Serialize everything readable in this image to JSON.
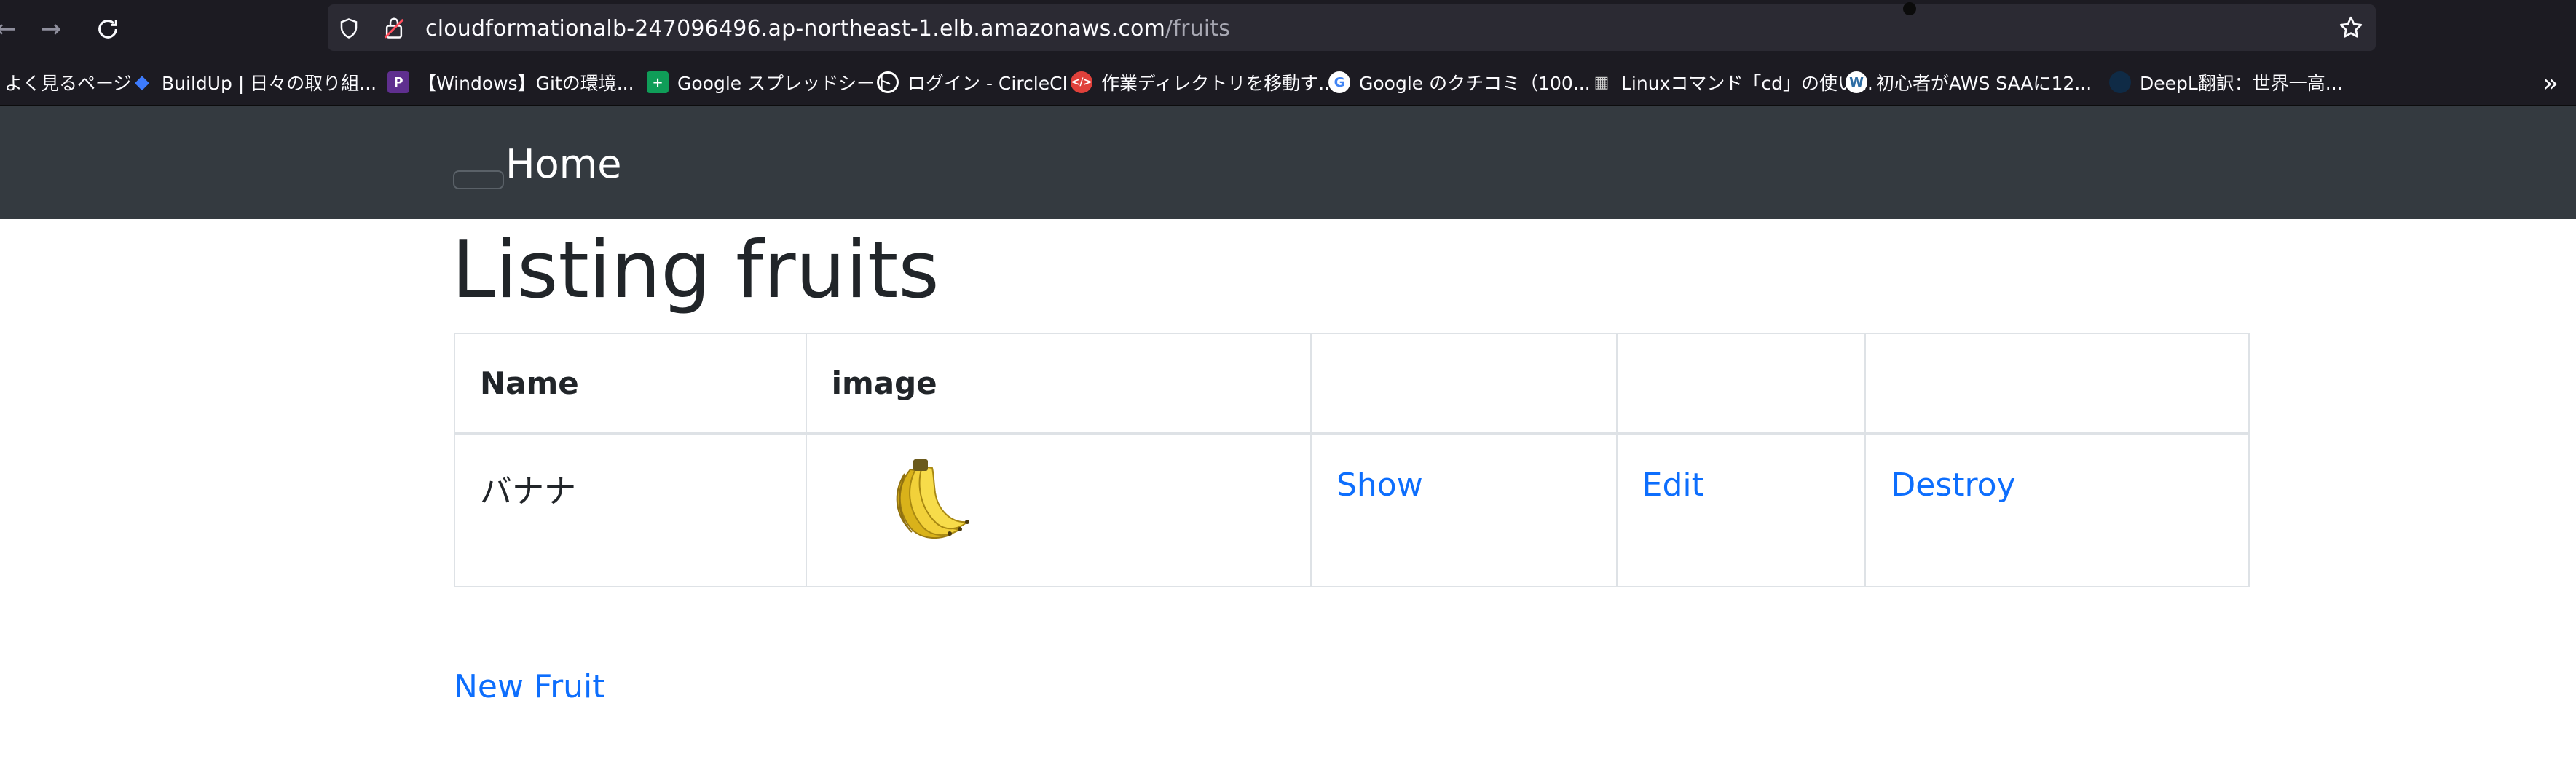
{
  "browser": {
    "url_host": "cloudformationalb-247096496.ap-northeast-1.elb.amazonaws.com",
    "url_path": "/fruits",
    "bookmarks": [
      {
        "label": "よく見るページ",
        "icon": "folder-icon",
        "color": ""
      },
      {
        "label": "BuildUp | 日々の取り組...",
        "icon": "buildup-icon",
        "color": "#3d7bfd"
      },
      {
        "label": "【Windows】Gitの環境...",
        "icon": "p-logo-icon",
        "color": "#5f2f8f"
      },
      {
        "label": "Google スプレッドシート",
        "icon": "sheets-icon",
        "color": "#0f9d58"
      },
      {
        "label": "ログイン - CircleCI",
        "icon": "circleci-icon",
        "color": "#ffffff"
      },
      {
        "label": "作業ディレクトリを移動す...",
        "icon": "qiita-code-icon",
        "color": "#e0413b"
      },
      {
        "label": "Google のクチコミ（100...",
        "icon": "google-icon",
        "color": "#ffffff"
      },
      {
        "label": "Linuxコマンド「cd」の使い...",
        "icon": "linux-site-icon",
        "color": "#cfcfcf"
      },
      {
        "label": "初心者がAWS SAAに12...",
        "icon": "wordpress-icon",
        "color": "#2e6da4"
      },
      {
        "label": "DeepL翻訳：世界一高...",
        "icon": "deepl-icon",
        "color": "#0f2b46"
      }
    ]
  },
  "navbar": {
    "brand": "Home"
  },
  "main": {
    "title": "Listing fruits",
    "table": {
      "headers": [
        "Name",
        "image",
        "",
        "",
        ""
      ],
      "rows": [
        {
          "name": "バナナ",
          "image": "banana-image",
          "show": "Show",
          "edit": "Edit",
          "destroy": "Destroy"
        }
      ]
    },
    "new_link": "New Fruit"
  },
  "colors": {
    "navbar_bg": "#343a40",
    "link": "#0d6efd",
    "chrome_bg": "#1c1b22"
  }
}
